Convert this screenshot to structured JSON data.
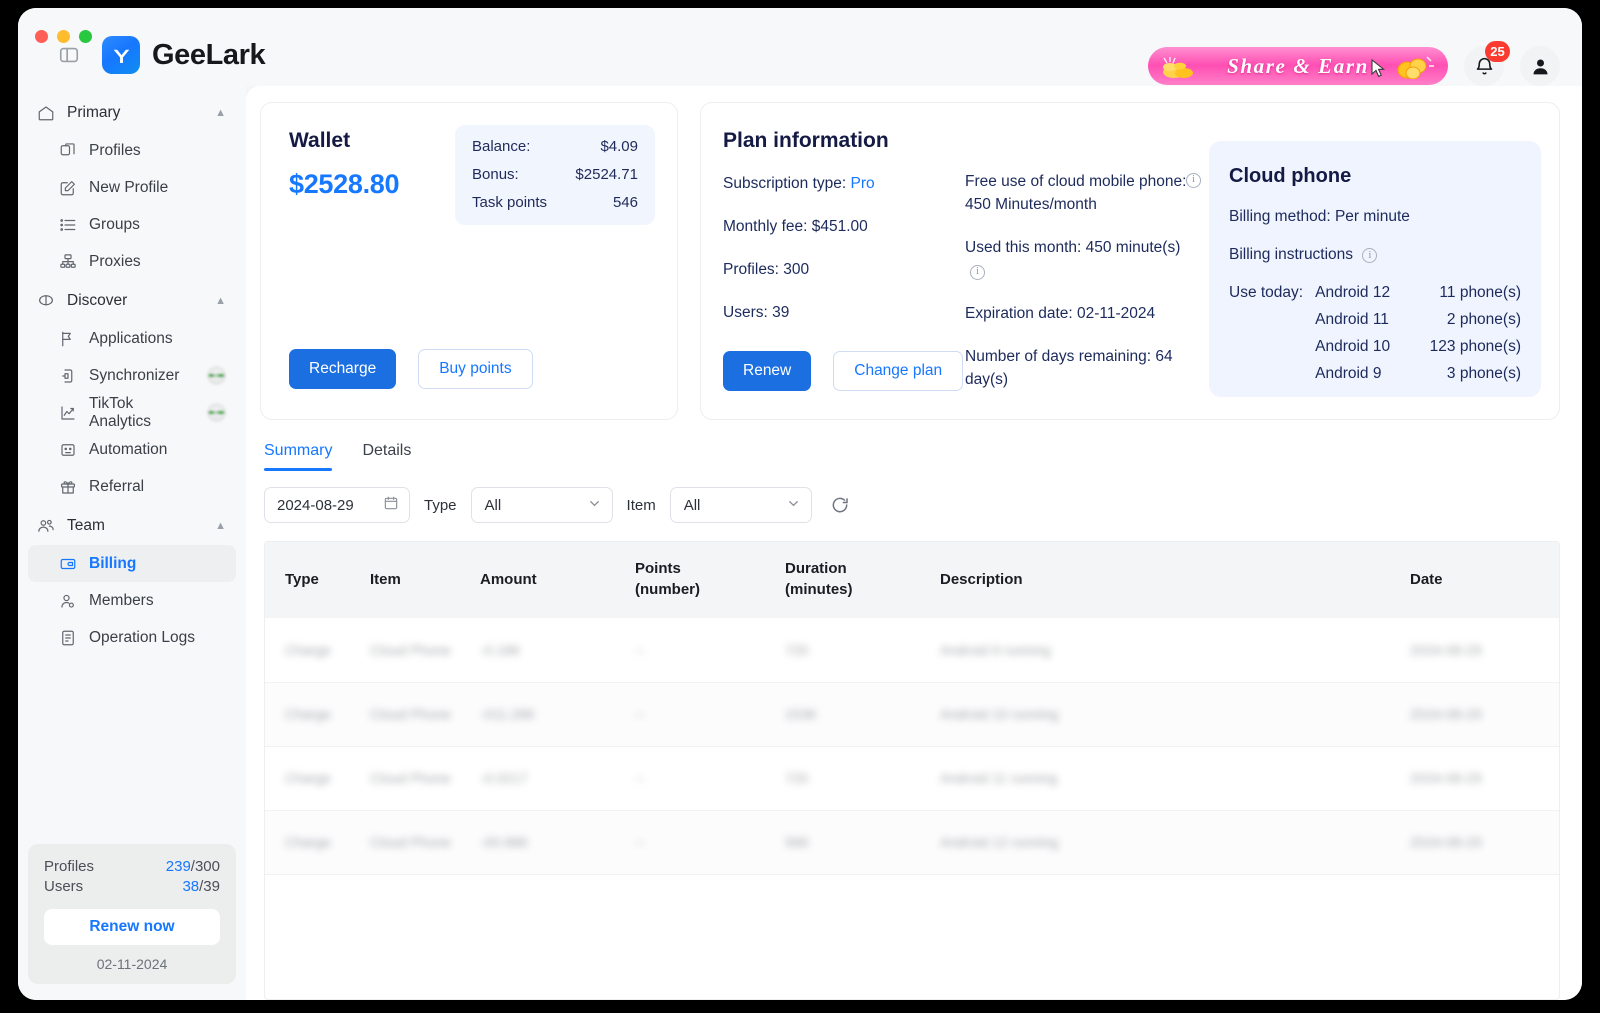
{
  "window": {
    "traffic_lights": [
      "close",
      "minimize",
      "maximize"
    ],
    "panel_toggle_icon": "sidebar-toggle-icon"
  },
  "brand": {
    "name": "GeeLark",
    "mark_icon": "geelark-logo-icon"
  },
  "header": {
    "promo_label": "Share & Earn",
    "notification_count": "25",
    "bell_icon": "bell-icon",
    "avatar_icon": "user-avatar-icon"
  },
  "sidebar": {
    "groups": [
      {
        "label": "Primary",
        "icon": "home-icon",
        "chevron": "chevron-up-icon",
        "items": [
          {
            "label": "Profiles",
            "icon": "profiles-icon",
            "badge": false
          },
          {
            "label": "New Profile",
            "icon": "new-profile-icon",
            "badge": false
          },
          {
            "label": "Groups",
            "icon": "list-icon",
            "badge": false
          },
          {
            "label": "Proxies",
            "icon": "proxies-icon",
            "badge": false
          }
        ]
      },
      {
        "label": "Discover",
        "icon": "discover-icon",
        "chevron": "chevron-up-icon",
        "items": [
          {
            "label": "Applications",
            "icon": "applications-icon",
            "badge": false
          },
          {
            "label": "Synchronizer",
            "icon": "synchronizer-icon",
            "badge": true
          },
          {
            "label": "TikTok Analytics",
            "icon": "analytics-icon",
            "badge": true
          },
          {
            "label": "Automation",
            "icon": "automation-icon",
            "badge": false
          },
          {
            "label": "Referral",
            "icon": "gift-icon",
            "badge": false
          }
        ]
      },
      {
        "label": "Team",
        "icon": "team-icon",
        "chevron": "chevron-up-icon",
        "items": [
          {
            "label": "Billing",
            "icon": "billing-icon",
            "badge": false,
            "active": true
          },
          {
            "label": "Members",
            "icon": "members-icon",
            "badge": false
          },
          {
            "label": "Operation Logs",
            "icon": "logs-icon",
            "badge": false
          }
        ]
      }
    ],
    "footer": {
      "profiles_label": "Profiles",
      "profiles_used": "239",
      "profiles_total": "/300",
      "users_label": "Users",
      "users_used": "38",
      "users_total": "/39",
      "renew_button": "Renew now",
      "renew_date": "02-11-2024"
    }
  },
  "wallet": {
    "title": "Wallet",
    "amount": "$2528.80",
    "stats": [
      {
        "label": "Balance:",
        "value": "$4.09"
      },
      {
        "label": "Bonus:",
        "value": "$2524.71"
      },
      {
        "label": "Task points",
        "value": "546"
      }
    ],
    "recharge_button": "Recharge",
    "buy_points_button": "Buy points"
  },
  "plan": {
    "title": "Plan information",
    "subscription_label": "Subscription type:",
    "subscription_value": "Pro",
    "monthly_fee": "Monthly fee: $451.00",
    "profiles": "Profiles: 300",
    "users": "Users: 39",
    "free_use": "Free use of cloud mobile phone: 450 Minutes/month",
    "used_this_month": "Used this month: 450 minute(s)",
    "expiration": "Expiration date: 02-11-2024",
    "days_remaining": "Number of days remaining: 64 day(s)",
    "renew_button": "Renew",
    "change_plan_button": "Change plan"
  },
  "cloud_phone": {
    "title": "Cloud phone",
    "billing_method": "Billing method:  Per minute",
    "billing_instructions": "Billing instructions",
    "use_today_label": "Use today:",
    "rows": [
      {
        "os": "Android 12",
        "count": "11 phone(s)"
      },
      {
        "os": "Android 11",
        "count": "2 phone(s)"
      },
      {
        "os": "Android 10",
        "count": "123 phone(s)"
      },
      {
        "os": "Android 9",
        "count": "3 phone(s)"
      }
    ]
  },
  "tabs": [
    {
      "label": "Summary",
      "active": true
    },
    {
      "label": "Details",
      "active": false
    }
  ],
  "filters": {
    "date_value": "2024-08-29",
    "calendar_icon": "calendar-icon",
    "type_label": "Type",
    "type_value": "All",
    "item_label": "Item",
    "item_value": "All",
    "refresh_icon": "refresh-icon"
  },
  "table": {
    "columns": [
      "Type",
      "Item",
      "Amount",
      "Points\n(number)",
      "Duration\n(minutes)",
      "Description",
      "Date"
    ],
    "columns_display": [
      {
        "line1": "Type",
        "line2": ""
      },
      {
        "line1": "Item",
        "line2": ""
      },
      {
        "line1": "Amount",
        "line2": ""
      },
      {
        "line1": "Points",
        "line2": "(number)"
      },
      {
        "line1": "Duration",
        "line2": "(minutes)"
      },
      {
        "line1": "Description",
        "line2": ""
      },
      {
        "line1": "Date",
        "line2": ""
      }
    ],
    "rows": [
      {
        "type": "Charge",
        "item": "Cloud Phone",
        "amount": "-0.186",
        "points": "--",
        "duration": "720",
        "description": "Android 9 running",
        "date": "2024-08-29",
        "redacted": true
      },
      {
        "type": "Charge",
        "item": "Cloud Phone",
        "amount": "-011.286",
        "points": "--",
        "duration": "1536",
        "description": "Android 10 running",
        "date": "2024-08-29",
        "redacted": true
      },
      {
        "type": "Charge",
        "item": "Cloud Phone",
        "amount": "-0.0217",
        "points": "--",
        "duration": "720",
        "description": "Android 11 running",
        "date": "2024-08-29",
        "redacted": true
      },
      {
        "type": "Charge",
        "item": "Cloud Phone",
        "amount": "-00.986",
        "points": "--",
        "duration": "566",
        "description": "Android 12 running",
        "date": "2024-08-29",
        "redacted": true
      }
    ]
  }
}
